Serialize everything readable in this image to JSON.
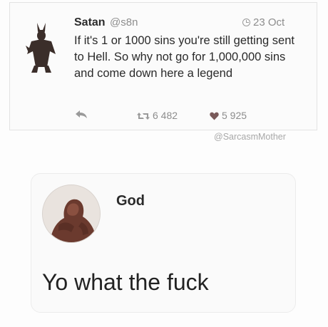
{
  "tweet": {
    "author_name": "Satan",
    "author_handle": "@s8n",
    "date": "23 Oct",
    "text": "If it's 1 or 1000 sins you're still getting sent to Hell. So why not go for 1,000,000 sins and come down here a legend",
    "retweets": "6 482",
    "likes": "5 925"
  },
  "watermark": "@SarcasmMother",
  "reply": {
    "author_name": "God",
    "text": "Yo what the fuck"
  },
  "colors": {
    "secondary_text": "#8d8d8d",
    "primary_text": "#2a2a2a",
    "like_heart": "#7a5a5a",
    "avatar_satan": "#3b2e2a",
    "avatar_god": "#6b3a2e"
  },
  "icons": {
    "satan_avatar": "devil-figure-icon",
    "date": "clock-icon",
    "reply": "reply-icon",
    "retweet": "retweet-icon",
    "like": "heart-icon",
    "god_avatar": "ape-figure-icon"
  }
}
